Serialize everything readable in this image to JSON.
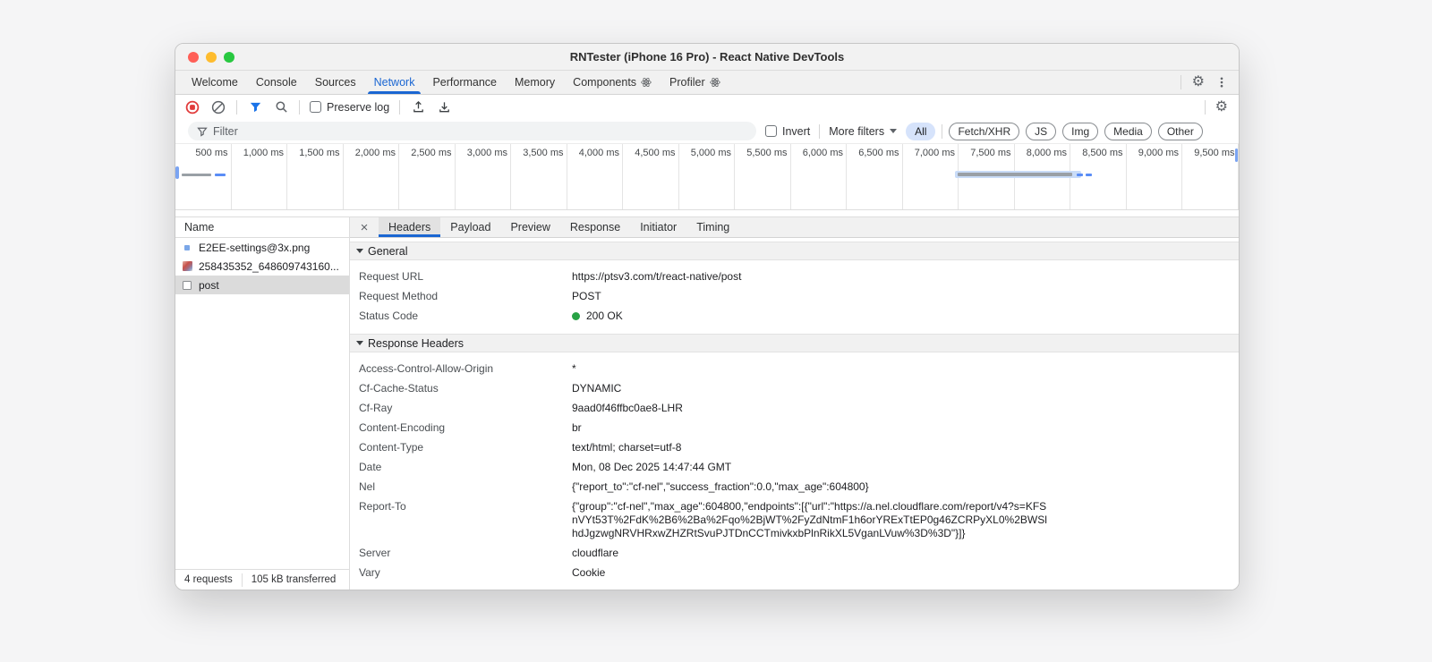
{
  "window": {
    "title": "RNTester (iPhone 16 Pro) - React Native DevTools"
  },
  "main_tabs": {
    "items": [
      {
        "label": "Welcome"
      },
      {
        "label": "Console"
      },
      {
        "label": "Sources"
      },
      {
        "label": "Network"
      },
      {
        "label": "Performance"
      },
      {
        "label": "Memory"
      },
      {
        "label": "Components"
      },
      {
        "label": "Profiler"
      }
    ],
    "active": "Network"
  },
  "toolbar": {
    "preserve_log_label": "Preserve log",
    "preserve_log_checked": false
  },
  "filter_bar": {
    "placeholder": "Filter",
    "value": "",
    "invert_label": "Invert",
    "invert_checked": false,
    "more_filters_label": "More filters",
    "pills": [
      {
        "label": "All",
        "active": true
      },
      {
        "label": "Fetch/XHR",
        "active": false
      },
      {
        "label": "JS",
        "active": false
      },
      {
        "label": "Img",
        "active": false
      },
      {
        "label": "Media",
        "active": false
      },
      {
        "label": "Other",
        "active": false
      }
    ]
  },
  "timeline": {
    "ticks": [
      "500 ms",
      "1,000 ms",
      "1,500 ms",
      "2,000 ms",
      "2,500 ms",
      "3,000 ms",
      "3,500 ms",
      "4,000 ms",
      "4,500 ms",
      "5,000 ms",
      "5,500 ms",
      "6,000 ms",
      "6,500 ms",
      "7,000 ms",
      "7,500 ms",
      "8,000 ms",
      "8,500 ms",
      "9,000 ms",
      "9,500 ms"
    ]
  },
  "sidebar": {
    "name_header": "Name",
    "requests": [
      {
        "name": "E2EE-settings@3x.png",
        "icon": "image-file-icon",
        "selected": false
      },
      {
        "name": "258435352_648609743160...",
        "icon": "image-thumbnail-icon",
        "selected": false
      },
      {
        "name": "post",
        "icon": "document-icon",
        "selected": true
      }
    ],
    "status": {
      "requests": "4 requests",
      "transferred": "105 kB transferred"
    }
  },
  "details": {
    "tabs": [
      {
        "label": "Headers"
      },
      {
        "label": "Payload"
      },
      {
        "label": "Preview"
      },
      {
        "label": "Response"
      },
      {
        "label": "Initiator"
      },
      {
        "label": "Timing"
      }
    ],
    "active_tab": "Headers",
    "general": {
      "title": "General",
      "rows": [
        {
          "key": "Request URL",
          "value": "https://ptsv3.com/t/react-native/post"
        },
        {
          "key": "Request Method",
          "value": "POST"
        },
        {
          "key": "Status Code",
          "value": "200 OK"
        }
      ],
      "status_dot_color": "#27a245"
    },
    "response_headers": {
      "title": "Response Headers",
      "rows": [
        {
          "key": "Access-Control-Allow-Origin",
          "value": "*"
        },
        {
          "key": "Cf-Cache-Status",
          "value": "DYNAMIC"
        },
        {
          "key": "Cf-Ray",
          "value": "9aad0f46ffbc0ae8-LHR"
        },
        {
          "key": "Content-Encoding",
          "value": "br"
        },
        {
          "key": "Content-Type",
          "value": "text/html; charset=utf-8"
        },
        {
          "key": "Date",
          "value": "Mon, 08 Dec 2025 14:47:44 GMT"
        },
        {
          "key": "Nel",
          "value": "{\"report_to\":\"cf-nel\",\"success_fraction\":0.0,\"max_age\":604800}"
        },
        {
          "key": "Report-To",
          "value": "{\"group\":\"cf-nel\",\"max_age\":604800,\"endpoints\":[{\"url\":\"https://a.nel.cloudflare.com/report/v4?s=KFSnVYt53T%2FdK%2B6%2Ba%2Fqo%2BjWT%2FyZdNtmF1h6orYRExTtEP0g46ZCRPyXL0%2BWSlhdJgzwgNRVHRxwZHZRtSvuPJTDnCCTmivkxbPlnRikXL5VganLVuw%3D%3D\"}]}"
        },
        {
          "key": "Server",
          "value": "cloudflare"
        },
        {
          "key": "Vary",
          "value": "Cookie"
        }
      ]
    }
  },
  "colors": {
    "accent_blue": "#1a66d2",
    "record_red": "#e13b3b",
    "status_green": "#27a245",
    "filter_funnel_blue": "#1a73e8",
    "active_pill_bg": "#d6e3fb",
    "selected_row_bg": "#dbdbdb"
  }
}
